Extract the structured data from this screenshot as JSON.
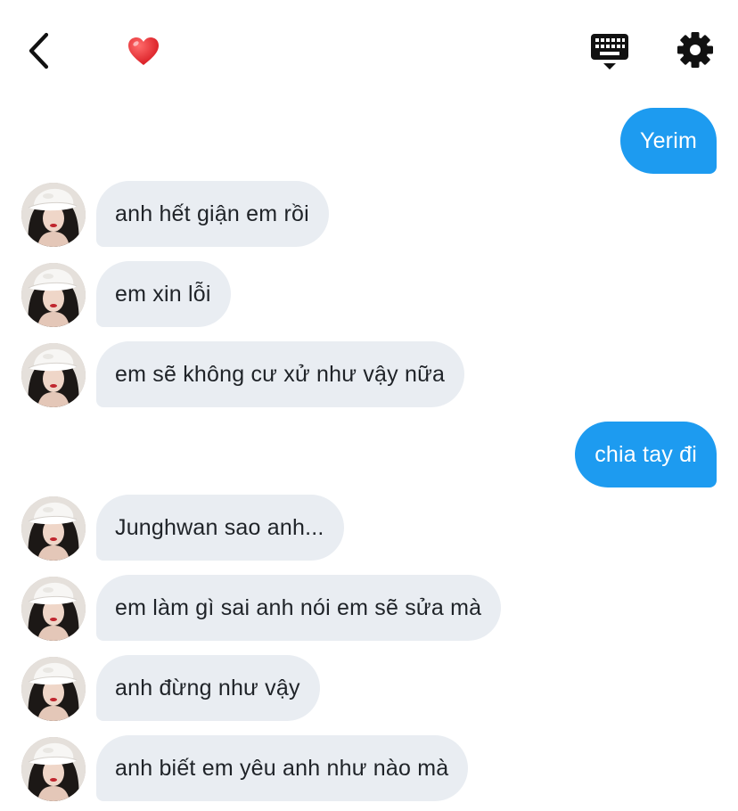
{
  "header": {
    "back_icon": "chevron-left-icon",
    "heart_emoji": "❤️",
    "keyboard_icon": "keyboard-icon",
    "settings_icon": "gear-icon"
  },
  "colors": {
    "outgoing_bubble": "#1d9bf0",
    "incoming_bubble": "#e9edf2",
    "text_dark": "#1f2328"
  },
  "messages": [
    {
      "direction": "out",
      "text": "Yerim"
    },
    {
      "direction": "in",
      "text": "anh hết giận em rồi"
    },
    {
      "direction": "in",
      "text": "em xin lỗi"
    },
    {
      "direction": "in",
      "text": "em sẽ không cư xử như vậy nữa"
    },
    {
      "direction": "out",
      "text": "chia tay đi"
    },
    {
      "direction": "in",
      "text": "Junghwan sao anh..."
    },
    {
      "direction": "in",
      "text": "em làm gì sai anh nói em sẽ sửa mà"
    },
    {
      "direction": "in",
      "text": "anh đừng như vậy"
    },
    {
      "direction": "in",
      "text": "anh biết em yêu anh như nào mà"
    }
  ]
}
